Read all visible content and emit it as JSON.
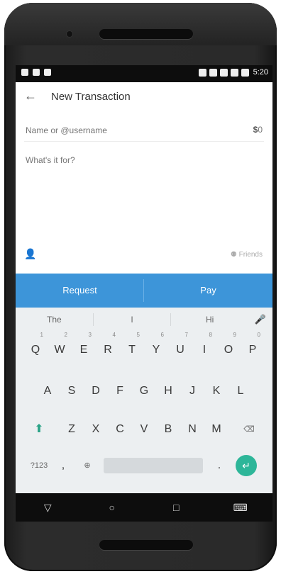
{
  "status_bar": {
    "time": "5:20"
  },
  "app_bar": {
    "back_icon": "arrow-left-icon",
    "title": "New Transaction"
  },
  "form": {
    "name_placeholder": "Name or @username",
    "amount_currency": "$",
    "amount_value": "0",
    "note_placeholder": "What's it for?",
    "friends_label": "Friends"
  },
  "actions": {
    "request_label": "Request",
    "pay_label": "Pay"
  },
  "keyboard": {
    "suggestions": [
      "The",
      "I",
      "Hi"
    ],
    "row1": [
      {
        "key": "Q",
        "hint": "1"
      },
      {
        "key": "W",
        "hint": "2"
      },
      {
        "key": "E",
        "hint": "3"
      },
      {
        "key": "R",
        "hint": "4"
      },
      {
        "key": "T",
        "hint": "5"
      },
      {
        "key": "Y",
        "hint": "6"
      },
      {
        "key": "U",
        "hint": "7"
      },
      {
        "key": "I",
        "hint": "8"
      },
      {
        "key": "O",
        "hint": "9"
      },
      {
        "key": "P",
        "hint": "0"
      }
    ],
    "row2": [
      "A",
      "S",
      "D",
      "F",
      "G",
      "H",
      "J",
      "K",
      "L"
    ],
    "row3": [
      "Z",
      "X",
      "C",
      "V",
      "B",
      "N",
      "M"
    ],
    "symbols_label": "?123",
    "comma_label": ",",
    "period_label": "."
  },
  "colors": {
    "accent_blue": "#3d95d9",
    "enter_green": "#2db699"
  }
}
